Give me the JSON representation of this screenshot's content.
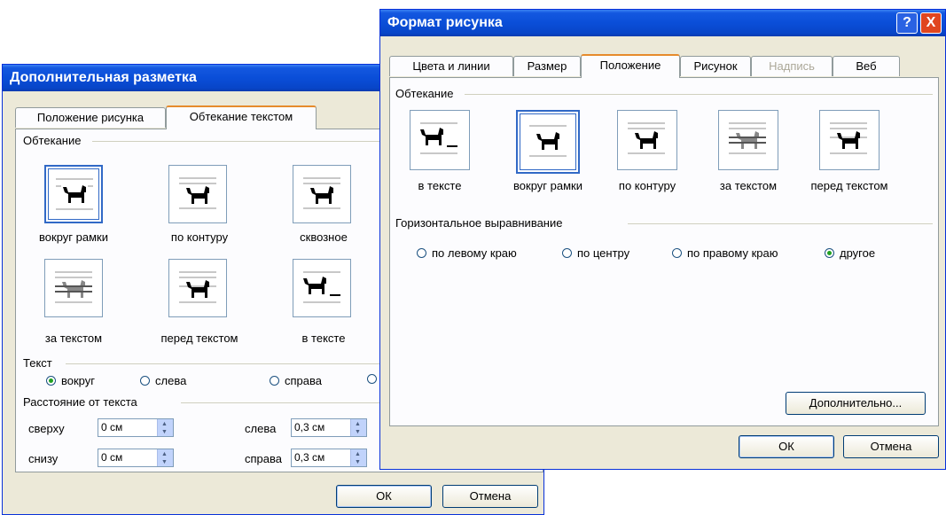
{
  "dialog_left": {
    "title": "Дополнительная разметка",
    "tabs": [
      "Положение рисунка",
      "Обтекание текстом"
    ],
    "wrap_group_label": "Обтекание",
    "wrap_options": [
      "вокруг рамки",
      "по контуру",
      "сквозное",
      "за текстом",
      "перед текстом",
      "в тексте"
    ],
    "text_group_label": "Текст",
    "text_options": [
      "вокруг",
      "слева",
      "справа"
    ],
    "distance_group_label": "Расстояние от текста",
    "top_label": "сверху",
    "top_value": "0 см",
    "bottom_label": "снизу",
    "bottom_value": "0 см",
    "left_label": "слева",
    "left_value": "0,3 см",
    "right_label": "справа",
    "right_value": "0,3 см",
    "ok_label": "ОК",
    "cancel_label": "Отмена"
  },
  "dialog_right": {
    "title": "Формат рисунка",
    "help_label": "?",
    "close_label": "X",
    "tabs": [
      "Цвета и линии",
      "Размер",
      "Положение",
      "Рисунок",
      "Надпись",
      "Веб"
    ],
    "wrap_group_label": "Обтекание",
    "wrap_options": [
      "в тексте",
      "вокруг рамки",
      "по контуру",
      "за текстом",
      "перед текстом"
    ],
    "halign_group_label": "Горизонтальное выравнивание",
    "halign_options": [
      "по левому краю",
      "по центру",
      "по правому краю",
      "другое"
    ],
    "advanced_label": "Дополнительно...",
    "ok_label": "ОК",
    "cancel_label": "Отмена"
  },
  "colors": {
    "titlebar": "#0a4ed8",
    "face": "#ece9d8",
    "selection": "#3169c6",
    "close": "#e0461f"
  }
}
